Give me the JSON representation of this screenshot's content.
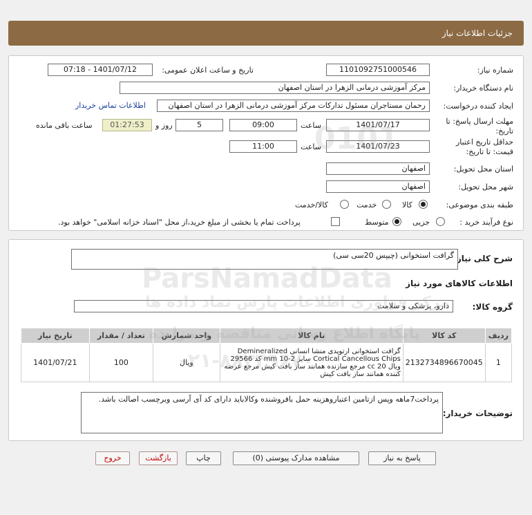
{
  "header": {
    "title": "جزئیات اطلاعات نیاز"
  },
  "form": {
    "need_number_label": "شماره نیاز:",
    "need_number": "1101092751000546",
    "announce_label": "تاریخ و ساعت اعلان عمومی:",
    "announce_value": "1401/07/12 - 07:18",
    "buyer_label": "نام دستگاه خریدار:",
    "buyer_value": "مرکز آموزشی درمانی الزهرا در استان اصفهان",
    "creator_label": "ایجاد کننده درخواست:",
    "creator_value": "رحمان مستاجران مسئول تدارکات مرکز آموزشی درمانی الزهرا در استان اصفهان",
    "contact_link": "اطلاعات تماس خریدار",
    "deadline_label": "مهلت ارسال پاسخ: تا",
    "deadline_label2": "تاریخ:",
    "deadline_date": "1401/07/17",
    "time_label": "ساعت",
    "deadline_time": "09:00",
    "days_value": "5",
    "days_label": "روز و",
    "remaining_value": "01:27:53",
    "remaining_label": "ساعت باقی مانده",
    "validity_label": "حداقل تاریخ اعتبار",
    "validity_label2": "قیمت: تا تاریخ:",
    "validity_date": "1401/07/23",
    "validity_time": "11:00",
    "province_label": "استان محل تحویل:",
    "province_value": "اصفهان",
    "city_label": "شهر محل تحویل:",
    "city_value": "اصفهان",
    "category_label": "طبقه بندی موضوعی:",
    "category_options": [
      "کالا",
      "خدمت",
      "کالا/خدمت"
    ],
    "process_label": "نوع فرآیند خرید :",
    "process_options": [
      "جزیی",
      "متوسط"
    ],
    "payment_text": "پرداخت تمام یا بخشی از مبلغ خرید،از محل \"اسناد خزانه اسلامی\" خواهد بود."
  },
  "summary": {
    "label": "شرح کلی نیاز:",
    "value": "گرافت استخوانی (چیپس 20سی سی)"
  },
  "goods": {
    "section_title": "اطلاعات کالاهای مورد نیاز",
    "group_label": "گروه کالا:",
    "group_value": "دارو، پزشکی و سلامت",
    "columns": [
      "ردیف",
      "کد کالا",
      "نام کالا",
      "واحد شمارش",
      "تعداد / مقدار",
      "تاریخ نیاز"
    ],
    "rows": [
      {
        "index": "1",
        "code": "2132734896670045",
        "name": "گرافت استخوانی ارتوپدی منشا انسانی Demineralized Cortical Cancellous Chips سایز mm 10-2 کد 29566 ویال 20 cc مرجع سازنده همانند ساز بافت کیش مرجع عرضه کننده همانند ساز بافت کیش",
        "unit": "ویال",
        "qty": "100",
        "date": "1401/07/21"
      }
    ]
  },
  "buyer_notes": {
    "label": "توضیحات خریدار:",
    "value": "پرداخت7ماهه وپس ازتامین اعتباروهزینه حمل بافروشنده وکالاباید دارای کد آی آرسی وبرچسب اصالت باشد."
  },
  "buttons": {
    "reply": "پاسخ به نیاز",
    "docs": "مشاهده مدارک پیوستی (0)",
    "print": "چاپ",
    "back": "بازگشت",
    "exit": "خروج"
  },
  "watermark": {
    "brand": "ParsNamadData",
    "line1": "مرکز فراوری اطلاعات پارس نماد داده ها",
    "line2": "پایگاه اطلاع رسانی مناقصه و مزایده",
    "phone": "۰۲۱-۸۸۳۴۹۶۷۰",
    "code": "0101"
  },
  "colors": {
    "header_bg": "#8b6a44",
    "link": "#1a3f9f",
    "remaining_bg": "#efefc9"
  }
}
